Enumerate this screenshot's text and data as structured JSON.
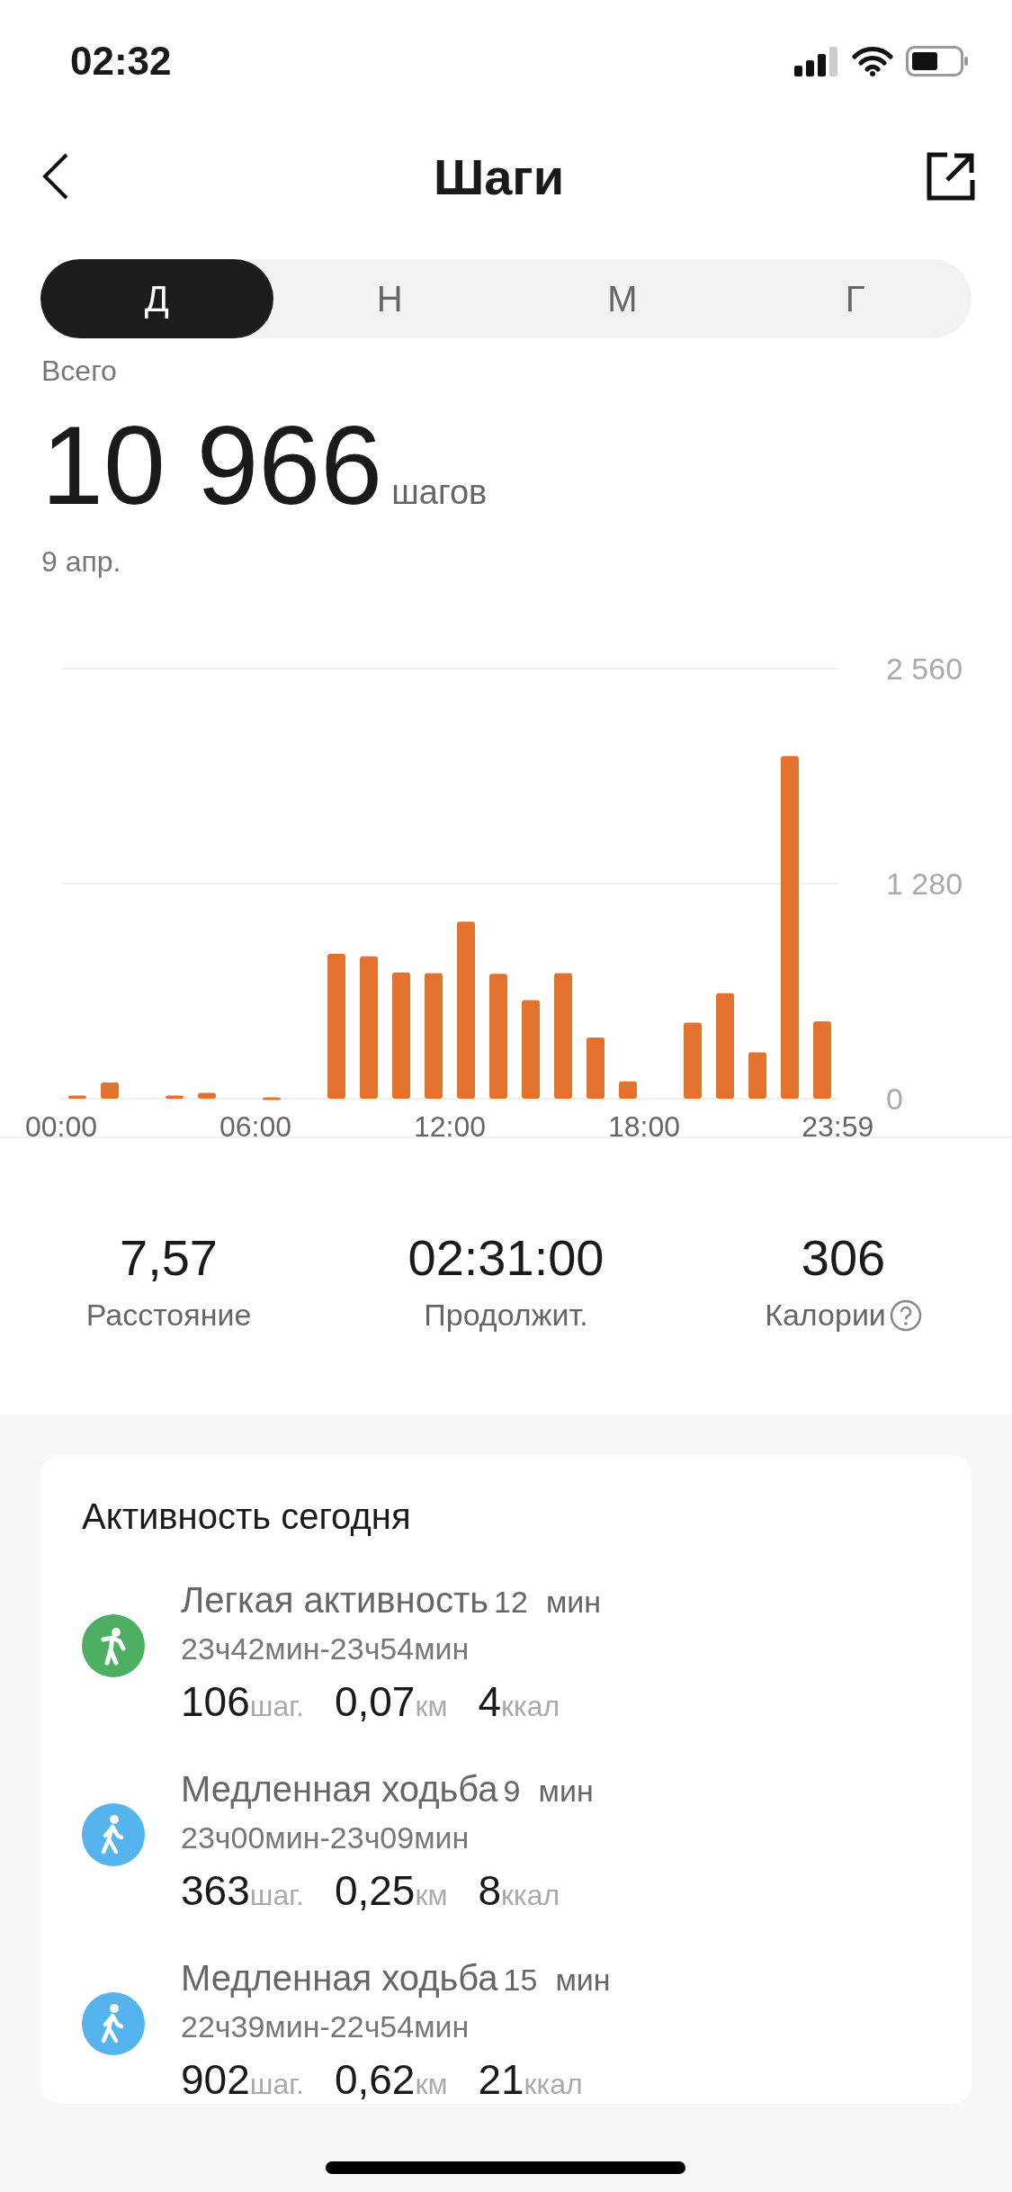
{
  "status_bar": {
    "time": "02:32"
  },
  "header": {
    "title": "Шаги"
  },
  "tabs": [
    {
      "label": "Д",
      "selected": true
    },
    {
      "label": "Н",
      "selected": false
    },
    {
      "label": "М",
      "selected": false
    },
    {
      "label": "Г",
      "selected": false
    }
  ],
  "summary": {
    "label": "Всего",
    "value": "10 966",
    "unit": "шагов",
    "date": "9 апр."
  },
  "chart_data": {
    "type": "bar",
    "x": [
      0.5,
      1.5,
      3.5,
      4.5,
      6.5,
      8.5,
      9.5,
      10.5,
      11.5,
      12.5,
      13.5,
      14.5,
      15.5,
      16.5,
      17.5,
      19.5,
      20.5,
      21.5,
      22.5,
      23.5
    ],
    "values": [
      19,
      96,
      19,
      35,
      8,
      862,
      847,
      751,
      747,
      1054,
      743,
      586,
      747,
      364,
      103,
      452,
      628,
      276,
      2039,
      460
    ],
    "ylim": [
      0,
      2560
    ],
    "xlim": [
      0,
      24
    ],
    "yticks": [
      0,
      {
        "value": 1280,
        "label": "1 280"
      },
      {
        "value": 2560,
        "label": "2 560"
      }
    ],
    "xticks": [
      {
        "value": 0,
        "label": "00:00"
      },
      {
        "value": 6,
        "label": "06:00"
      },
      {
        "value": 12,
        "label": "12:00"
      },
      {
        "value": 18,
        "label": "18:00"
      },
      {
        "value": 23.98,
        "label": "23:59"
      }
    ]
  },
  "stats": [
    {
      "value": "7,57",
      "label": "Расстояние",
      "help": false
    },
    {
      "value": "02:31:00",
      "label": "Продолжит.",
      "help": false
    },
    {
      "value": "306",
      "label": "Калории",
      "help": true
    }
  ],
  "activities": {
    "title": "Активность сегодня",
    "items": [
      {
        "kind": "light",
        "name": "Легкая активность",
        "duration": "12",
        "duration_unit": "мин",
        "range": "23ч42мин-23ч54мин",
        "steps": "106",
        "steps_unit": "шаг.",
        "distance": "0,07",
        "distance_unit": "км",
        "kcal": "4",
        "kcal_unit": "ккал"
      },
      {
        "kind": "walk",
        "name": "Медленная ходьба",
        "duration": "9",
        "duration_unit": "мин",
        "range": "23ч00мин-23ч09мин",
        "steps": "363",
        "steps_unit": "шаг.",
        "distance": "0,25",
        "distance_unit": "км",
        "kcal": "8",
        "kcal_unit": "ккал"
      },
      {
        "kind": "walk",
        "name": "Медленная ходьба",
        "duration": "15",
        "duration_unit": "мин",
        "range": "22ч39мин-22ч54мин",
        "steps": "902",
        "steps_unit": "шаг.",
        "distance": "0,62",
        "distance_unit": "км",
        "kcal": "21",
        "kcal_unit": "ккал"
      }
    ]
  }
}
